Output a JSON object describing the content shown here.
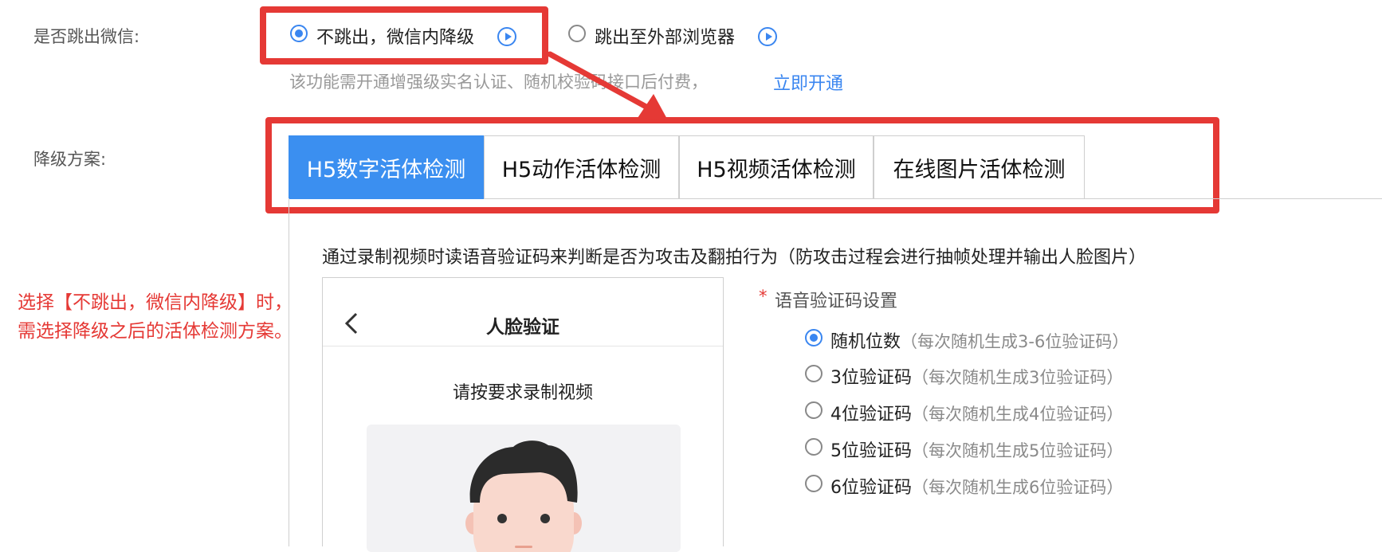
{
  "jump": {
    "label": "是否跳出微信:",
    "option1": "不跳出，微信内降级",
    "option2": "跳出至外部浏览器",
    "hint": "该功能需开通增强级实名认证、随机校验码接口后付费，",
    "hint_link": "立即开通"
  },
  "downgrade": {
    "label": "降级方案:",
    "tabs": [
      "H5数字活体检测",
      "H5动作活体检测",
      "H5视频活体检测",
      "在线图片活体检测"
    ]
  },
  "description": "通过录制视频时读语音验证码来判断是否为攻击及翻拍行为（防攻击过程会进行抽帧处理并输出人脸图片）",
  "annotation": {
    "line1": "选择【不跳出，微信内降级】时，",
    "line2": "需选择降级之后的活体检测方案。"
  },
  "phone": {
    "title": "人脸验证",
    "subtitle": "请按要求录制视频"
  },
  "voice": {
    "required_mark": "*",
    "label": "语音验证码设置",
    "options": [
      {
        "main": "随机位数",
        "hint": "（每次随机生成3-6位验证码）"
      },
      {
        "main": "3位验证码",
        "hint": "（每次随机生成3位验证码）"
      },
      {
        "main": "4位验证码",
        "hint": "（每次随机生成4位验证码）"
      },
      {
        "main": "5位验证码",
        "hint": "（每次随机生成5位验证码）"
      },
      {
        "main": "6位验证码",
        "hint": "（每次随机生成6位验证码）"
      }
    ]
  },
  "colors": {
    "accent": "#3a86f0",
    "annotation_red": "#e53935"
  }
}
